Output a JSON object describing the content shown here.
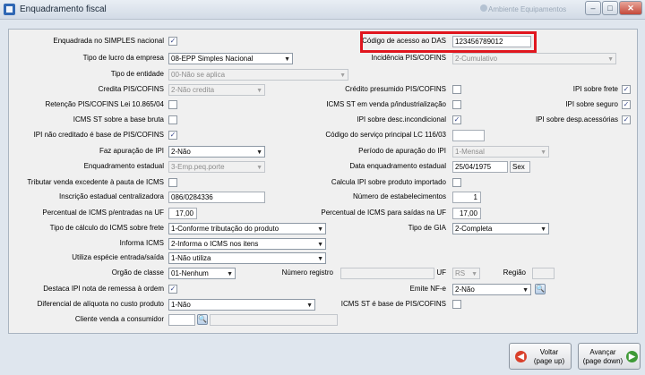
{
  "window": {
    "title": "Enquadramento fiscal",
    "ghost_text": "Ambiente Equipamentos",
    "minimize": "–",
    "maximize": "□",
    "close": "✕"
  },
  "fields": {
    "simples": {
      "label": "Enquadrada no SIMPLES nacional",
      "checked": "✓"
    },
    "codigo_acesso_das": {
      "label": "Código de acesso ao DAS",
      "value": "123456789012"
    },
    "tipo_lucro": {
      "label": "Tipo de lucro da empresa",
      "value": "08-EPP Simples Nacional"
    },
    "incidencia_pis_cofins": {
      "label": "Incidência PIS/COFINS",
      "value": "2-Cumulativo"
    },
    "tipo_entidade": {
      "label": "Tipo de entidade",
      "value": "00-Não se aplica"
    },
    "credita_pis_cofins": {
      "label": "Credita PIS/COFINS",
      "value": "2-Não credita"
    },
    "credito_presumido": {
      "label": "Crédito presumido PIS/COFINS",
      "checked": ""
    },
    "ipi_sobre_frete": {
      "label": "IPI sobre frete",
      "checked": "✓"
    },
    "retencao_pis_cofins": {
      "label": "Retenção PIS/COFINS Lei 10.865/04",
      "checked": ""
    },
    "icms_st_venda_industrializacao": {
      "label": "ICMS ST em venda p/industrialização",
      "checked": ""
    },
    "ipi_sobre_seguro": {
      "label": "IPI sobre seguro",
      "checked": "✓"
    },
    "icms_st_base_bruta": {
      "label": "ICMS ST sobre a base bruta",
      "checked": ""
    },
    "ipi_desc_incondicional": {
      "label": "IPI sobre desc.incondicional",
      "checked": "✓"
    },
    "ipi_desp_acessorias": {
      "label": "IPI sobre desp.acessórias",
      "checked": "✓"
    },
    "ipi_nao_creditado": {
      "label": "IPI não creditado é base de PIS/COFINS",
      "checked": "✓"
    },
    "codigo_servico_lc116": {
      "label": "Código do serviço principal LC 116/03",
      "value": ""
    },
    "faz_apuracao_ipi": {
      "label": "Faz apuração de IPI",
      "value": "2-Não"
    },
    "periodo_apuracao_ipi": {
      "label": "Período de apuração do IPI",
      "value": "1-Mensal"
    },
    "enquadramento_estadual": {
      "label": "Enquadramento estadual",
      "value": "3-Emp.peq.porte"
    },
    "data_enquadramento_estadual": {
      "label": "Data enquadramento estadual",
      "value": "25/04/1975",
      "weekday": "Sex"
    },
    "tributar_venda_pauta": {
      "label": "Tributar venda excedente à pauta de ICMS",
      "checked": ""
    },
    "calcula_ipi_importado": {
      "label": "Calcula IPI sobre produto importado",
      "checked": ""
    },
    "inscricao_centralizadora": {
      "label": "Inscrição estadual centralizadora",
      "value": "086/0284336"
    },
    "numero_estabelecimentos": {
      "label": "Número de estabelecimentos",
      "value": "1"
    },
    "perc_icms_entradas": {
      "label": "Percentual de ICMS p/entradas na UF",
      "value": "17,00"
    },
    "perc_icms_saidas": {
      "label": "Percentual de ICMS para saídas na UF",
      "value": "17,00"
    },
    "tipo_calculo_icms_frete": {
      "label": "Tipo de cálculo do ICMS sobre frete",
      "value": "1-Conforme tributação do produto"
    },
    "tipo_gia": {
      "label": "Tipo de GIA",
      "value": "2-Completa"
    },
    "informa_icms": {
      "label": "Informa ICMS",
      "value": "2-Informa o ICMS nos itens"
    },
    "utiliza_especie": {
      "label": "Utiliza espécie entrada/saída",
      "value": "1-Não utiliza"
    },
    "orgao_classe": {
      "label": "Orgão de classe",
      "value": "01-Nenhum"
    },
    "numero_registro": {
      "label": "Número registro",
      "value": ""
    },
    "uf": {
      "label": "UF",
      "value": "RS"
    },
    "regiao": {
      "label": "Região",
      "value": ""
    },
    "destaca_ipi_remessa": {
      "label": "Destaca IPI nota de remessa à ordem",
      "checked": "✓"
    },
    "emite_nfe": {
      "label": "Emite NF-e",
      "value": "2-Não"
    },
    "diferencial_aliquota": {
      "label": "Diferencial de alíquota no custo produto",
      "value": "1-Não"
    },
    "icms_st_base_pis_cofins": {
      "label": "ICMS ST é base de PIS/COFINS",
      "checked": ""
    },
    "cliente_venda_consumidor": {
      "label": "Cliente venda a consumidor",
      "value": ""
    }
  },
  "icons": {
    "dropdown": "▼",
    "lookup": "🔍",
    "back": "◀",
    "forward": "▶"
  },
  "buttons": {
    "voltar": {
      "line1": "Voltar",
      "line2": "(page up)"
    },
    "avancar": {
      "line1": "Avançar",
      "line2": "(page down)"
    }
  },
  "colors": {
    "highlight_box": "#e0161e",
    "back_icon": "#d9402b",
    "forward_icon": "#3f9a37"
  }
}
